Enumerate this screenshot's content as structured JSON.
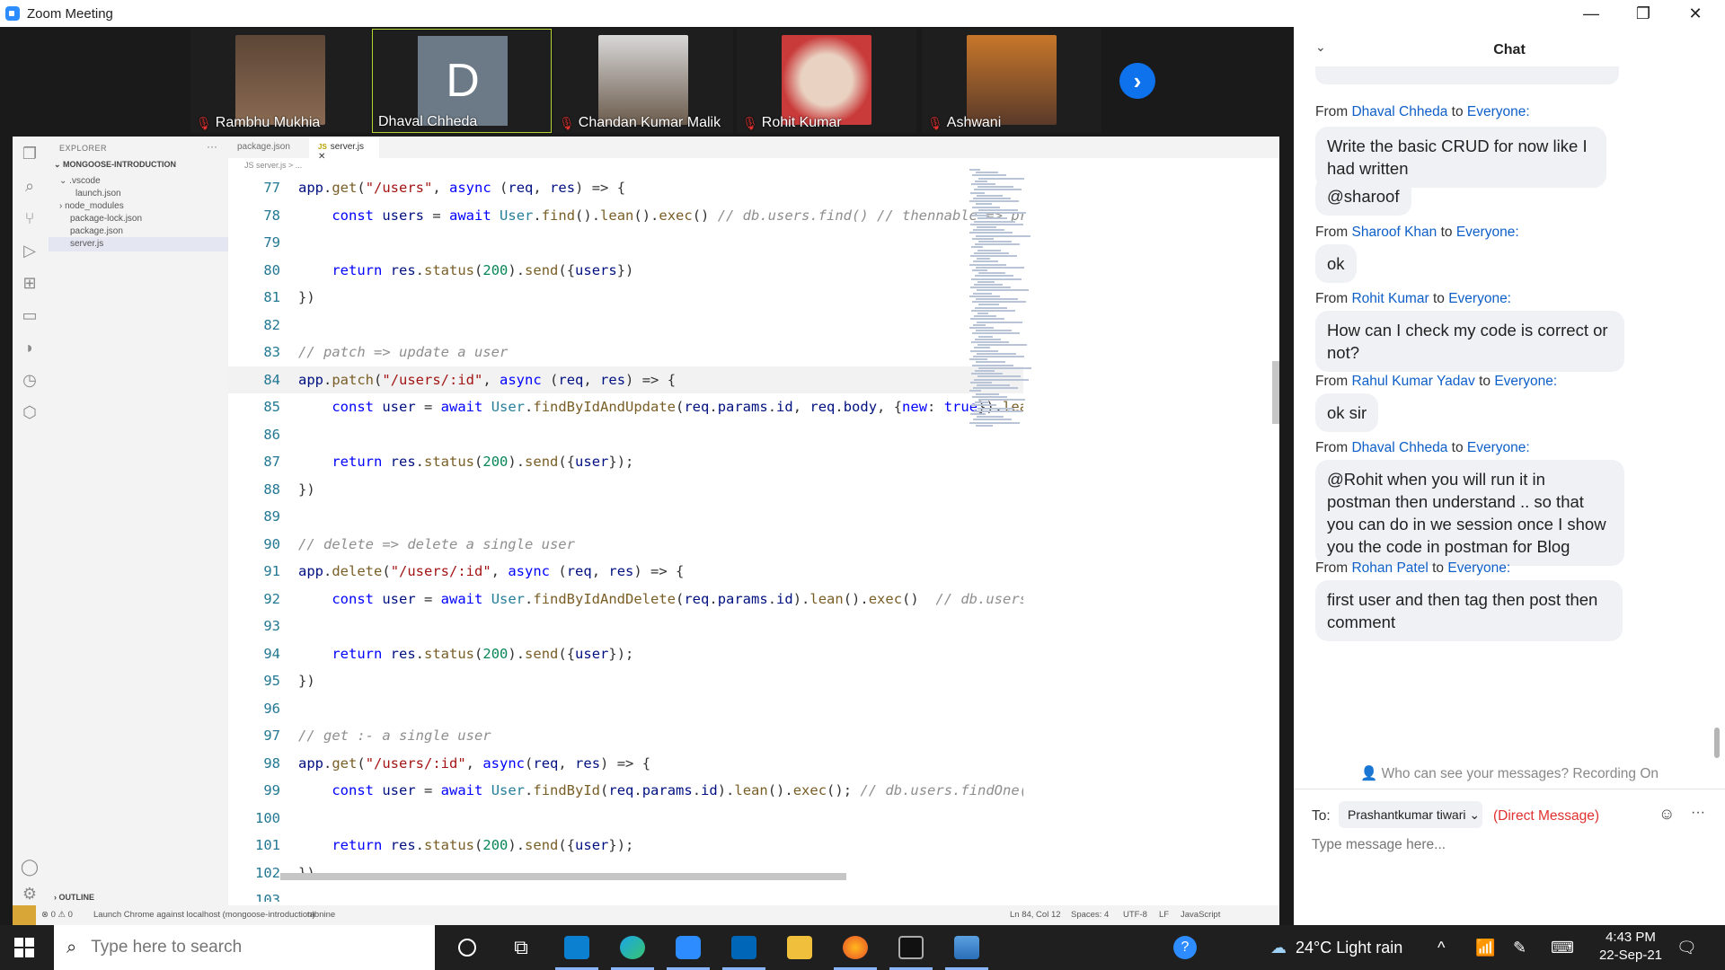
{
  "window": {
    "title": "Zoom Meeting",
    "minimize": "—",
    "maximize": "❐",
    "close": "✕"
  },
  "participants": [
    {
      "name": "Rambhu Mukhia",
      "muted": true,
      "color": "#7a5a44"
    },
    {
      "name": "Dhaval Chheda",
      "muted": false,
      "initial": "D"
    },
    {
      "name": "Chandan Kumar Malik",
      "muted": true,
      "color": "#6b5b4c"
    },
    {
      "name": "Rohit Kumar",
      "muted": true,
      "color": "#c93a3a"
    },
    {
      "name": "Ashwani",
      "muted": true,
      "color": "#c8772a"
    }
  ],
  "next_arrow": "›",
  "vscode": {
    "explorer_title": "EXPLORER",
    "explorer_more": "···",
    "project": "MONGOOSE-INTRODUCTION",
    "files": [
      ".vscode",
      "launch.json",
      "node_modules",
      "package-lock.json",
      "package.json",
      "server.js"
    ],
    "outline": "OUTLINE",
    "tabs": [
      "package.json",
      "server.js"
    ],
    "tab_close": "✕",
    "breadcrumb": "JS server.js > ...",
    "status": {
      "errors": "⊗ 0 ⚠ 0",
      "launch": "Launch Chrome against localhost (mongoose-introduction)",
      "tabnine": "tabnine",
      "position": "Ln 84, Col 12",
      "spaces": "Spaces: 4",
      "encoding": "UTF-8",
      "eol": "LF",
      "language": "JavaScript"
    },
    "lines": [
      {
        "n": "77",
        "code": "app.get(\"/users\", async (req, res) => {"
      },
      {
        "n": "78",
        "code": "    const users = await User.find().lean().exec() // db.users.find() // thennable => promise"
      },
      {
        "n": "79",
        "code": ""
      },
      {
        "n": "80",
        "code": "    return res.status(200).send({users})"
      },
      {
        "n": "81",
        "code": "})"
      },
      {
        "n": "82",
        "code": ""
      },
      {
        "n": "83",
        "code": "// patch => update a user"
      },
      {
        "n": "84",
        "code": "app.patch(\"/users/:id\", async (req, res) => {"
      },
      {
        "n": "85",
        "code": "    const user = await User.findByIdAndUpdate(req.params.id, req.body, {new: true}).lean().exec()  // db.users"
      },
      {
        "n": "86",
        "code": ""
      },
      {
        "n": "87",
        "code": "    return res.status(200).send({user});"
      },
      {
        "n": "88",
        "code": "})"
      },
      {
        "n": "89",
        "code": ""
      },
      {
        "n": "90",
        "code": "// delete => delete a single user"
      },
      {
        "n": "91",
        "code": "app.delete(\"/users/:id\", async (req, res) => {"
      },
      {
        "n": "92",
        "code": "    const user = await User.findByIdAndDelete(req.params.id).lean().exec()  // db.users.remove({_id: \"\"})"
      },
      {
        "n": "93",
        "code": ""
      },
      {
        "n": "94",
        "code": "    return res.status(200).send({user});"
      },
      {
        "n": "95",
        "code": "})"
      },
      {
        "n": "96",
        "code": ""
      },
      {
        "n": "97",
        "code": "// get :- a single user"
      },
      {
        "n": "98",
        "code": "app.get(\"/users/:id\", async(req, res) => {"
      },
      {
        "n": "99",
        "code": "    const user = await User.findById(req.params.id).lean().exec(); // db.users.findOne({_id: \"\"})"
      },
      {
        "n": "100",
        "code": ""
      },
      {
        "n": "101",
        "code": "    return res.status(200).send({user});"
      },
      {
        "n": "102",
        "code": "})"
      },
      {
        "n": "103",
        "code": ""
      }
    ]
  },
  "chat": {
    "title": "Chat",
    "collapse": "⌄",
    "from_word": "From",
    "to_word": "to",
    "messages": [
      {
        "from": "Dhaval Chheda",
        "to": "Everyone:",
        "bubbles": [
          "Write the basic CRUD for now like I had written",
          "@sharoof"
        ]
      },
      {
        "from": "Sharoof Khan",
        "to": "Everyone:",
        "bubbles": [
          "ok"
        ]
      },
      {
        "from": "Rohit Kumar",
        "to": "Everyone:",
        "bubbles": [
          "How can I check my code is correct or not?"
        ]
      },
      {
        "from": "Rahul Kumar Yadav",
        "to": "Everyone:",
        "bubbles": [
          "ok sir"
        ]
      },
      {
        "from": "Dhaval Chheda",
        "to": "Everyone:",
        "bubbles": [
          "@Rohit when you will run it in postman then understand .. so that you can do in we session once I show you the code in postman for Blog"
        ]
      },
      {
        "from": "Rohan Patel",
        "to": "Everyone:",
        "bubbles": [
          "first user and then tag then post then comment"
        ]
      }
    ],
    "who_can_see": "Who can see your messages? Recording On",
    "to_label": "To:",
    "recipient": "Prashantkumar tiwari",
    "direct": "(Direct Message)",
    "placeholder": "Type message here...",
    "emoji": "☺",
    "more": "···"
  },
  "taskbar": {
    "search_placeholder": "Type here to search",
    "weather": "24°C  Light rain",
    "time": "4:43 PM",
    "date": "22-Sep-21"
  }
}
